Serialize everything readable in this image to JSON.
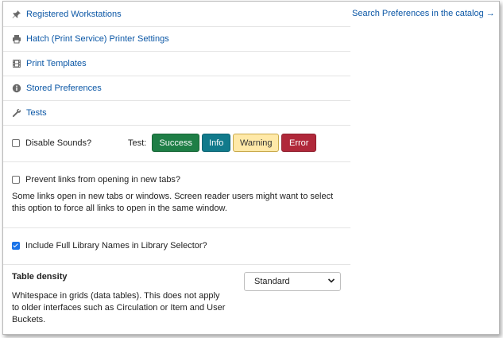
{
  "nav": {
    "items": [
      {
        "label": "Registered Workstations",
        "icon": "pin-icon"
      },
      {
        "label": "Hatch (Print Service) Printer Settings",
        "icon": "printer-icon"
      },
      {
        "label": "Print Templates",
        "icon": "film-icon"
      },
      {
        "label": "Stored Preferences",
        "icon": "info-circle-icon"
      },
      {
        "label": "Tests",
        "icon": "wrench-icon"
      }
    ]
  },
  "sounds": {
    "label": "Disable Sounds?",
    "checked": false,
    "test_label": "Test:",
    "buttons": {
      "success": "Success",
      "info": "Info",
      "warning": "Warning",
      "error": "Error"
    }
  },
  "links_pref": {
    "label": "Prevent links from opening in new tabs?",
    "checked": false,
    "description": "Some links open in new tabs or windows. Screen reader users might want to select this option to force all links to open in the same window."
  },
  "library_names": {
    "label": "Include Full Library Names in Library Selector?",
    "checked": true
  },
  "table_density": {
    "heading": "Table density",
    "description": "Whitespace in grids (data tables). This does not apply to older interfaces such as Circulation or Item and User Buckets.",
    "selected": "Standard"
  },
  "catalog_link": "Search Preferences in the catalog →",
  "colors": {
    "link": "#0b57a6",
    "success": "#1e7e46",
    "info": "#117a8b",
    "warning": "#ffe9a8",
    "error": "#b0283a"
  }
}
